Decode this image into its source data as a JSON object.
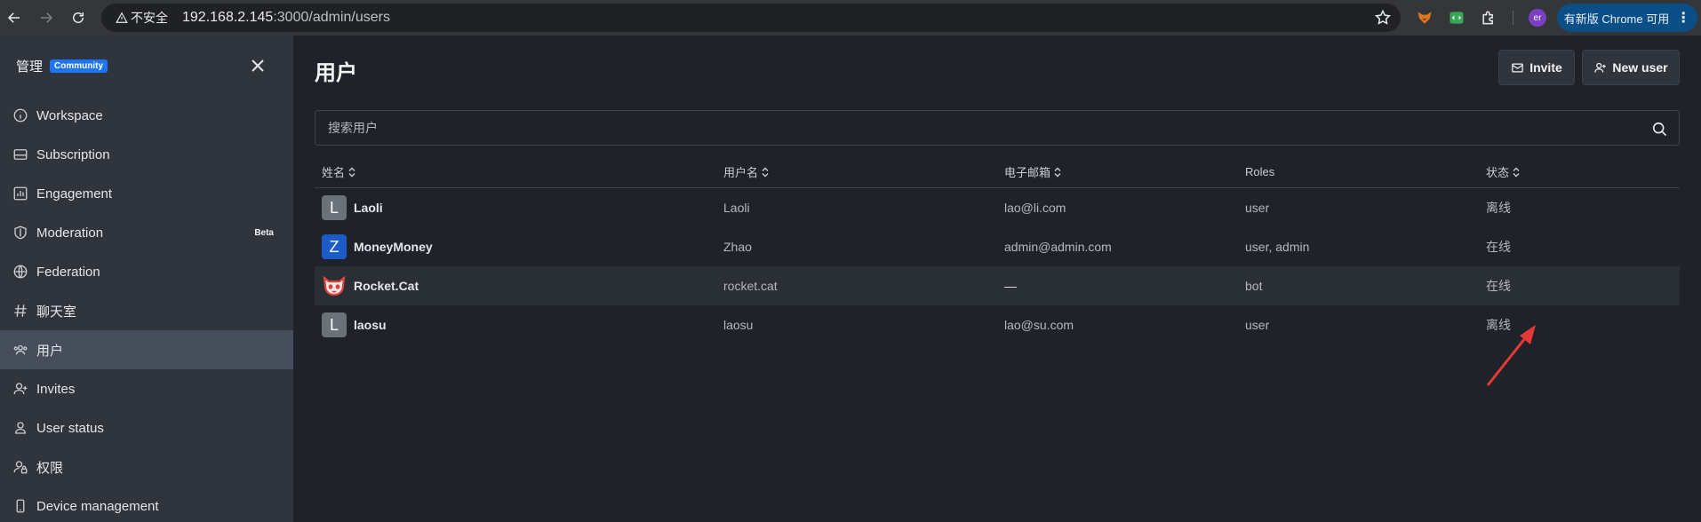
{
  "browser": {
    "security_label": "不安全",
    "url_host": "192.168.2.145",
    "url_path": ":3000/admin/users",
    "profile_initials": "er",
    "update_label": "有新版 Chrome 可用",
    "menu_glyph": "⋮"
  },
  "sidebar": {
    "title": "管理",
    "edition_badge": "Community",
    "items": [
      {
        "label": "Workspace",
        "icon": "info-icon"
      },
      {
        "label": "Subscription",
        "icon": "card-icon"
      },
      {
        "label": "Engagement",
        "icon": "chart-icon"
      },
      {
        "label": "Moderation",
        "icon": "shield-icon",
        "badge": "Beta"
      },
      {
        "label": "Federation",
        "icon": "globe-icon"
      },
      {
        "label": "聊天室",
        "icon": "hash-icon"
      },
      {
        "label": "用户",
        "icon": "team-icon",
        "active": true
      },
      {
        "label": "Invites",
        "icon": "user-plus-icon"
      },
      {
        "label": "User status",
        "icon": "user-icon"
      },
      {
        "label": "权限",
        "icon": "user-lock-icon"
      },
      {
        "label": "Device management",
        "icon": "mobile-icon"
      }
    ]
  },
  "main": {
    "title": "用户",
    "invite_label": "Invite",
    "new_user_label": "New user",
    "search_placeholder": "搜索用户",
    "columns": [
      "姓名",
      "用户名",
      "电子邮箱",
      "Roles",
      "状态"
    ],
    "rows": [
      {
        "avatar": "L",
        "avatar_color": "#6c727a",
        "name": "Laoli",
        "username": "Laoli",
        "email": "lao@li.com",
        "roles": "user",
        "status": "离线"
      },
      {
        "avatar": "Z",
        "avatar_color": "#1d5bc7",
        "name": "MoneyMoney",
        "username": "Zhao",
        "email": "admin@admin.com",
        "roles": "user, admin",
        "status": "在线"
      },
      {
        "avatar": "cat",
        "avatar_color": "#ffffff",
        "name": "Rocket.Cat",
        "username": "rocket.cat",
        "email": "—",
        "roles": "bot",
        "status": "在线"
      },
      {
        "avatar": "L",
        "avatar_color": "#6c727a",
        "name": "laosu",
        "username": "laosu",
        "email": "lao@su.com",
        "roles": "user",
        "status": "离线"
      }
    ]
  },
  "colors": {
    "accent": "#1d74f5",
    "annotation_arrow": "#e53935",
    "sidebar_bg": "#2f343d",
    "main_bg": "#1f2329"
  }
}
